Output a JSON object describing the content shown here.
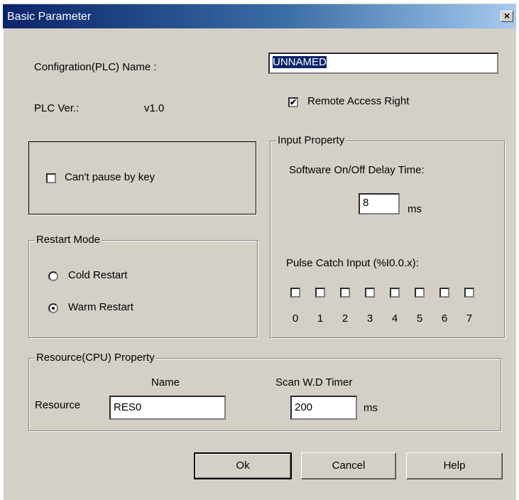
{
  "window": {
    "title": "Basic Parameter",
    "close_glyph": "×"
  },
  "config": {
    "name_label": "Configration(PLC) Name :",
    "name_value": "UNNAMED",
    "plc_ver_label": "PLC Ver.:",
    "plc_ver_value": "v1.0",
    "remote_access_label": "Remote Access Right",
    "remote_access_checked": true
  },
  "pause": {
    "label": "Can't pause by key",
    "checked": false
  },
  "restart_mode": {
    "legend": "Restart Mode",
    "options": [
      {
        "label": "Cold Restart",
        "selected": false
      },
      {
        "label": "Warm Restart",
        "selected": true
      }
    ]
  },
  "input_property": {
    "legend": "Input Property",
    "delay_label": "Software On/Off Delay Time:",
    "delay_value": "8",
    "delay_unit": "ms",
    "pulse_label": "Pulse Catch Input (%I0.0.x):",
    "pulse_bits": [
      "0",
      "1",
      "2",
      "3",
      "4",
      "5",
      "6",
      "7"
    ]
  },
  "resource_property": {
    "legend": "Resource(CPU) Property",
    "name_header": "Name",
    "timer_header": "Scan W.D Timer",
    "row_label": "Resource",
    "name_value": "RES0",
    "timer_value": "200",
    "timer_unit": "ms"
  },
  "buttons": {
    "ok": "Ok",
    "cancel": "Cancel",
    "help": "Help"
  }
}
